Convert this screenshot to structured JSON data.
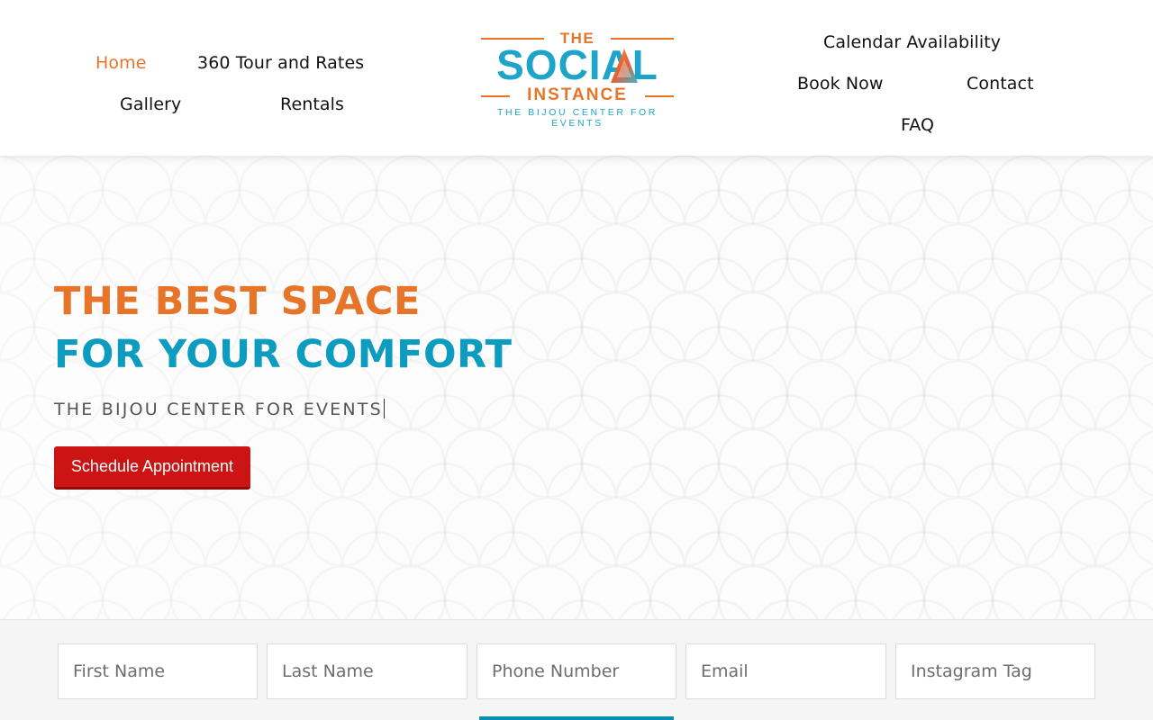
{
  "nav": {
    "left": [
      "Home",
      "360 Tour and Rates",
      "Gallery",
      "Rentals"
    ],
    "right": [
      "Calendar Availability",
      "Book Now",
      "Contact",
      "FAQ"
    ],
    "active": "Home"
  },
  "logo": {
    "the": "THE",
    "social": "SOCIAL",
    "instance": "INSTANCE",
    "tagline": "THE BIJOU CENTER FOR EVENTS"
  },
  "hero": {
    "headline_line1": "THE BEST SPACE",
    "headline_line2": "FOR YOUR COMFORT",
    "subheading": "THE BIJOU CENTER FOR EVENTS",
    "cta_label": "Schedule Appointment"
  },
  "form": {
    "fields": [
      {
        "placeholder": "First Name",
        "value": ""
      },
      {
        "placeholder": "Last Name",
        "value": ""
      },
      {
        "placeholder": "Phone Number",
        "value": ""
      },
      {
        "placeholder": "Email",
        "value": ""
      },
      {
        "placeholder": "Instagram Tag",
        "value": ""
      }
    ]
  },
  "colors": {
    "accent_orange": "#e6752a",
    "accent_teal": "#0b9cbf",
    "cta_red": "#cc1414"
  }
}
